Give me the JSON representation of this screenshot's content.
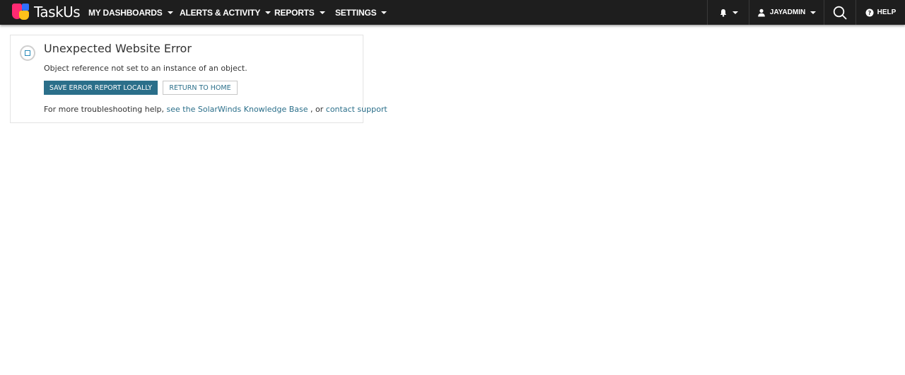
{
  "header": {
    "logo_text": "TaskUs",
    "nav": [
      {
        "label": "MY DASHBOARDS"
      },
      {
        "label": "ALERTS & ACTIVITY"
      },
      {
        "label": "REPORTS"
      },
      {
        "label": "SETTINGS"
      }
    ],
    "user_label": "JAYADMIN",
    "help_label": "HELP",
    "icons": {
      "notifications": "bell-icon",
      "user": "user-icon",
      "search": "search-icon",
      "help": "question-circle-icon"
    }
  },
  "error": {
    "title": "Unexpected Website Error",
    "message": "Object reference not set to an instance of an object.",
    "save_button": "SAVE ERROR REPORT LOCALLY",
    "home_button": "RETURN TO HOME",
    "help_prefix": "For more troubleshooting help,",
    "kb_link": "see the SolarWinds Knowledge Base",
    "separator": ", or",
    "support_link": "contact support"
  },
  "colors": {
    "topbar": "#1e1e1e",
    "primary_button": "#2b6f8a",
    "link": "#2b6f8a",
    "logo_pink": "#ff2a72",
    "logo_blue": "#2f6fff",
    "logo_yellow": "#ffc21a"
  }
}
